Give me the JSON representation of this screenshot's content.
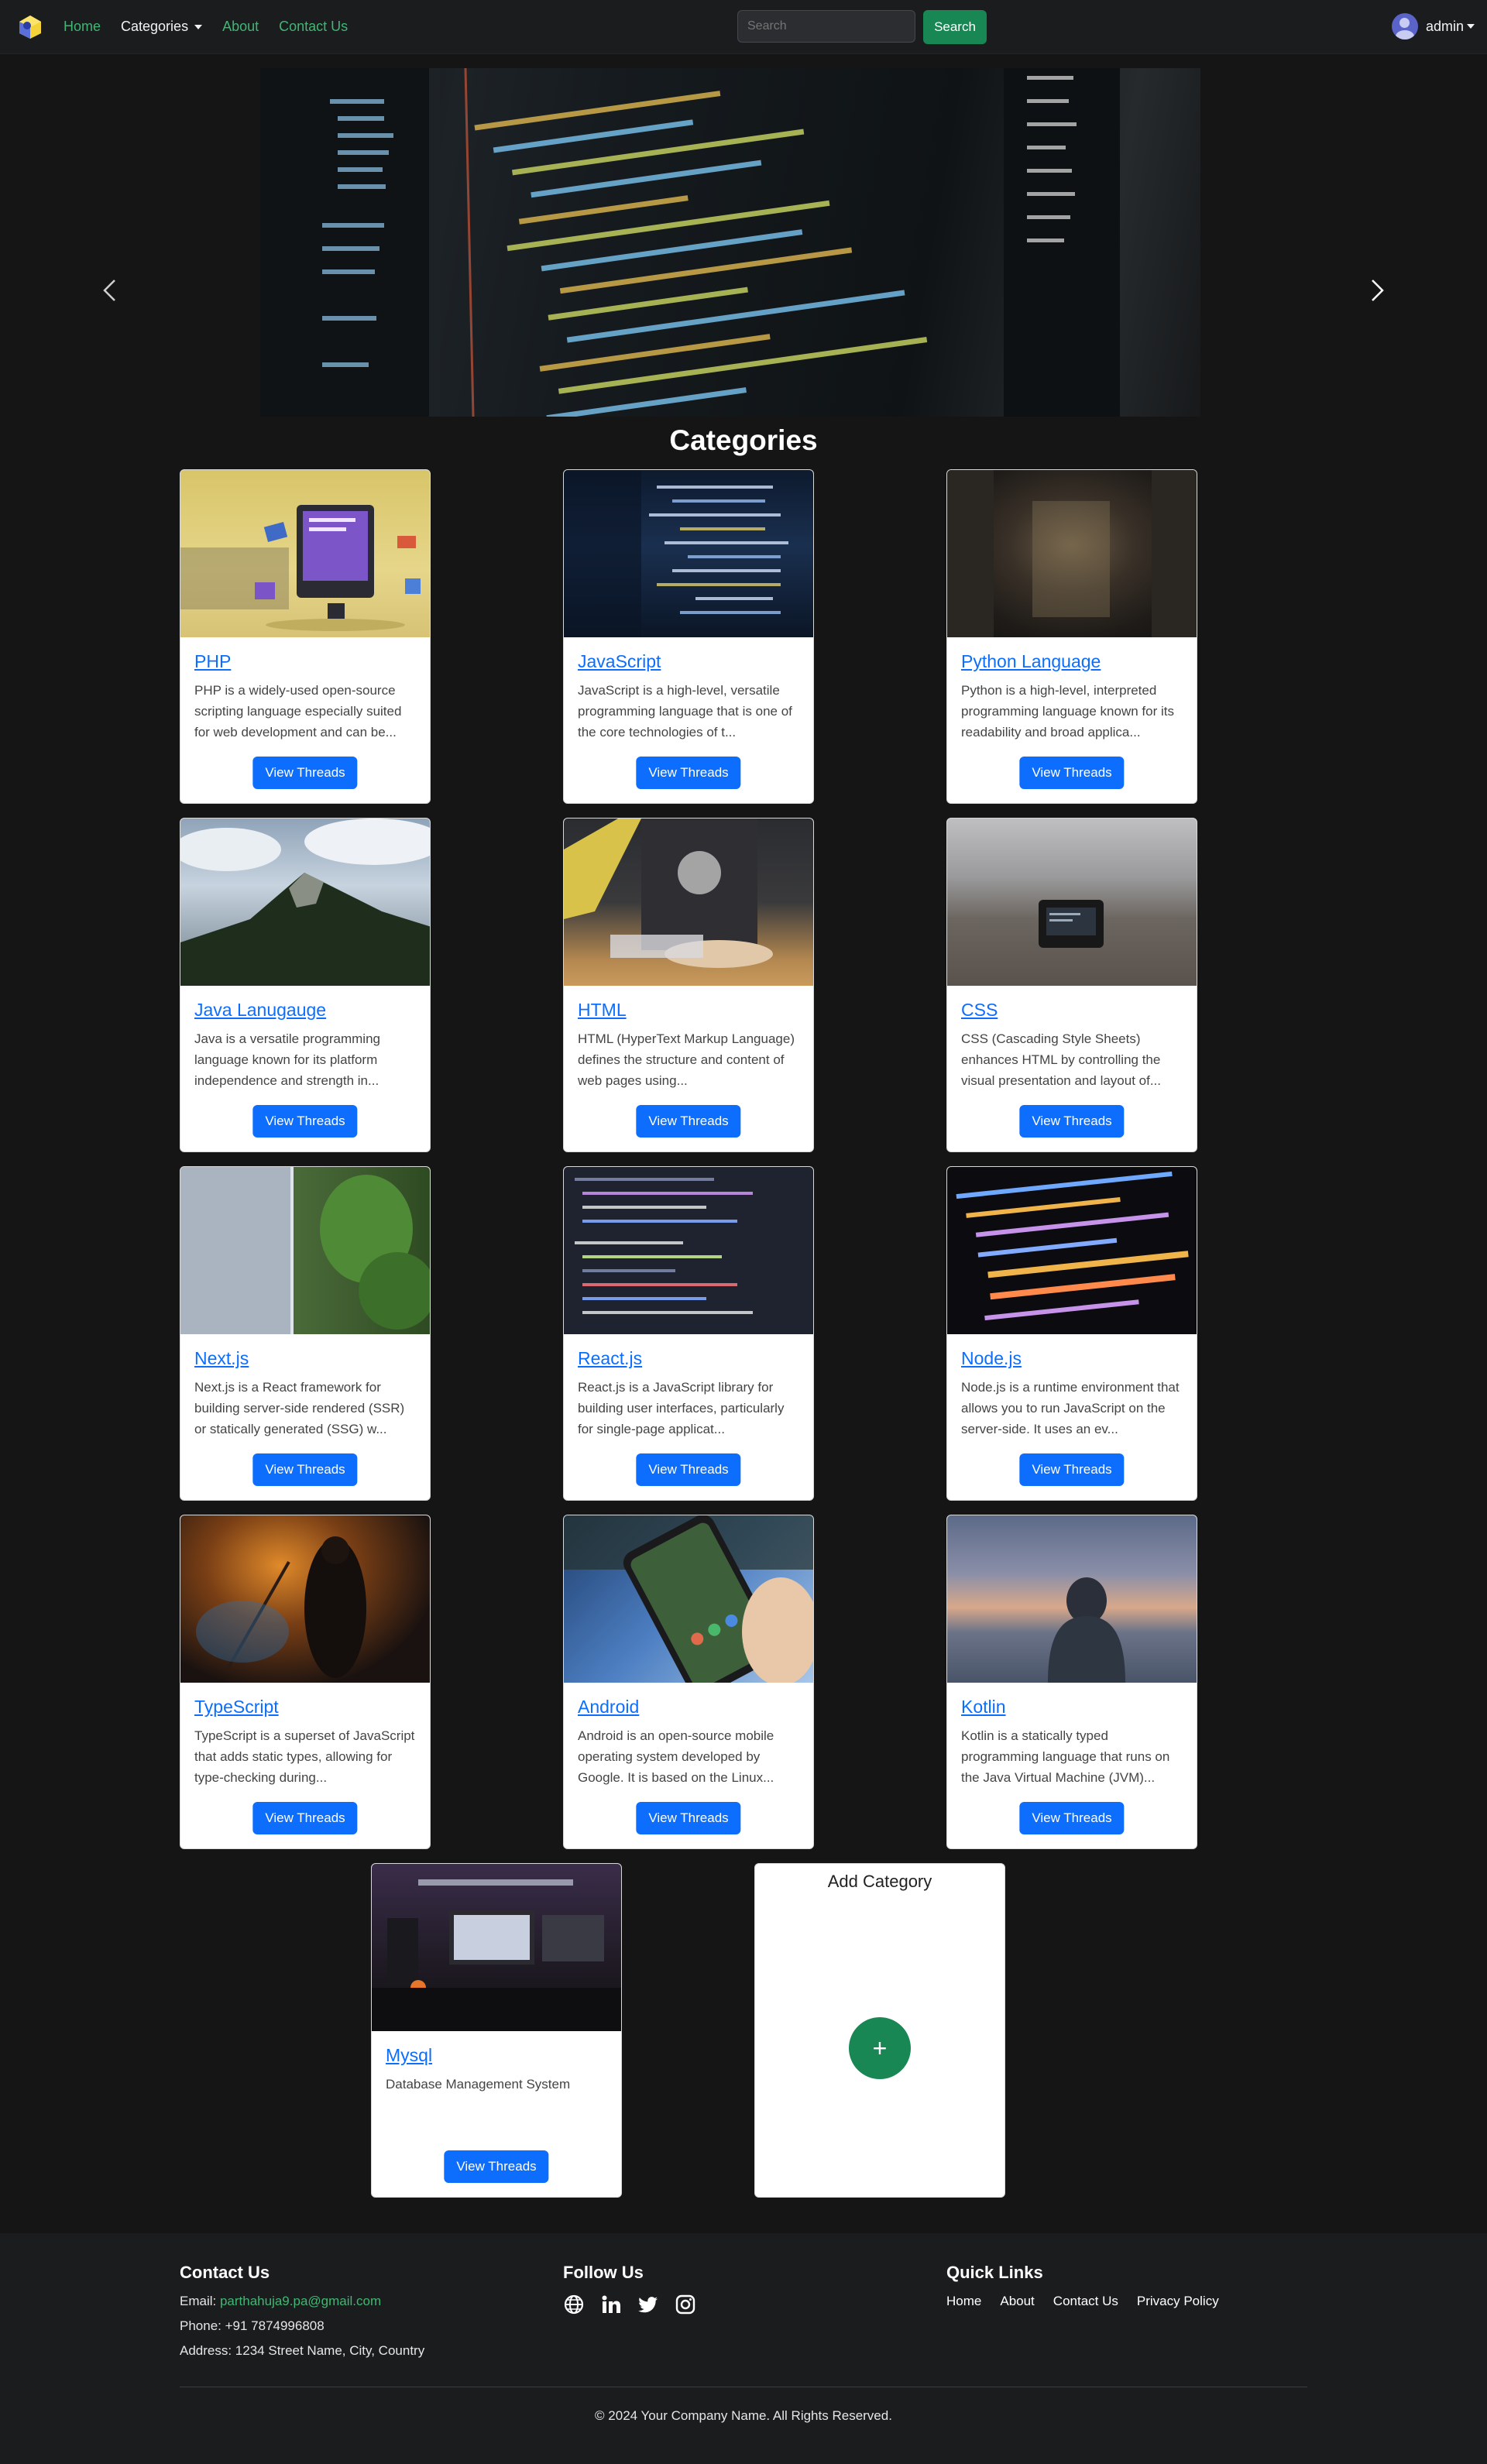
{
  "nav": {
    "links": [
      "Home",
      "Categories",
      "About",
      "Contact Us"
    ],
    "search_placeholder": "Search",
    "search_button": "Search",
    "user": "admin"
  },
  "section_title": "Categories",
  "categories": [
    {
      "title": "PHP",
      "desc": "PHP is a widely-used open-source scripting language especially suited for web development and can be...",
      "button": "View Threads"
    },
    {
      "title": "JavaScript",
      "desc": "JavaScript is a high-level, versatile programming language that is one of the core technologies of t...",
      "button": "View Threads"
    },
    {
      "title": "Python Language",
      "desc": "Python is a high-level, interpreted programming language known for its readability and broad applica...",
      "button": "View Threads"
    },
    {
      "title": "Java Lanugauge",
      "desc": "Java is a versatile programming language known for its platform independence and strength in...",
      "button": "View Threads"
    },
    {
      "title": "HTML",
      "desc": "HTML (HyperText Markup Language) defines the structure and content of web pages using...",
      "button": "View Threads"
    },
    {
      "title": "CSS",
      "desc": "CSS (Cascading Style Sheets) enhances HTML by controlling the visual presentation and layout of...",
      "button": "View Threads"
    },
    {
      "title": "Next.js",
      "desc": "Next.js is a React framework for building server-side rendered (SSR) or statically generated (SSG) w...",
      "button": "View Threads"
    },
    {
      "title": "React.js",
      "desc": "React.js is a JavaScript library for building user interfaces, particularly for single-page applicat...",
      "button": "View Threads"
    },
    {
      "title": "Node.js",
      "desc": "Node.js is a runtime environment that allows you to run JavaScript on the server-side. It uses an ev...",
      "button": "View Threads"
    },
    {
      "title": "TypeScript",
      "desc": "TypeScript is a superset of JavaScript that adds static types, allowing for type-checking during...",
      "button": "View Threads"
    },
    {
      "title": "Android",
      "desc": "Android is an open-source mobile operating system developed by Google. It is based on the Linux...",
      "button": "View Threads"
    },
    {
      "title": "Kotlin",
      "desc": "Kotlin is a statically typed programming language that runs on the Java Virtual Machine (JVM)...",
      "button": "View Threads"
    },
    {
      "title": "Mysql",
      "desc": "Database Management System",
      "button": "View Threads"
    }
  ],
  "add_category": {
    "title": "Add Category",
    "button": "+"
  },
  "footer": {
    "contact_title": "Contact Us",
    "email_label": "Email:",
    "email": "parthahuja9.pa@gmail.com",
    "phone": "Phone: +91 7874996808",
    "address": "Address: 1234 Street Name, City, Country",
    "follow_title": "Follow Us",
    "quick_title": "Quick Links",
    "quick_links": [
      "Home",
      "About",
      "Contact Us",
      "Privacy Policy"
    ],
    "copyright": "© 2024 Your Company Name. All Rights Reserved."
  },
  "colors": {
    "accent_green": "#198754",
    "link_blue": "#0d6efd",
    "background": "#151515"
  }
}
